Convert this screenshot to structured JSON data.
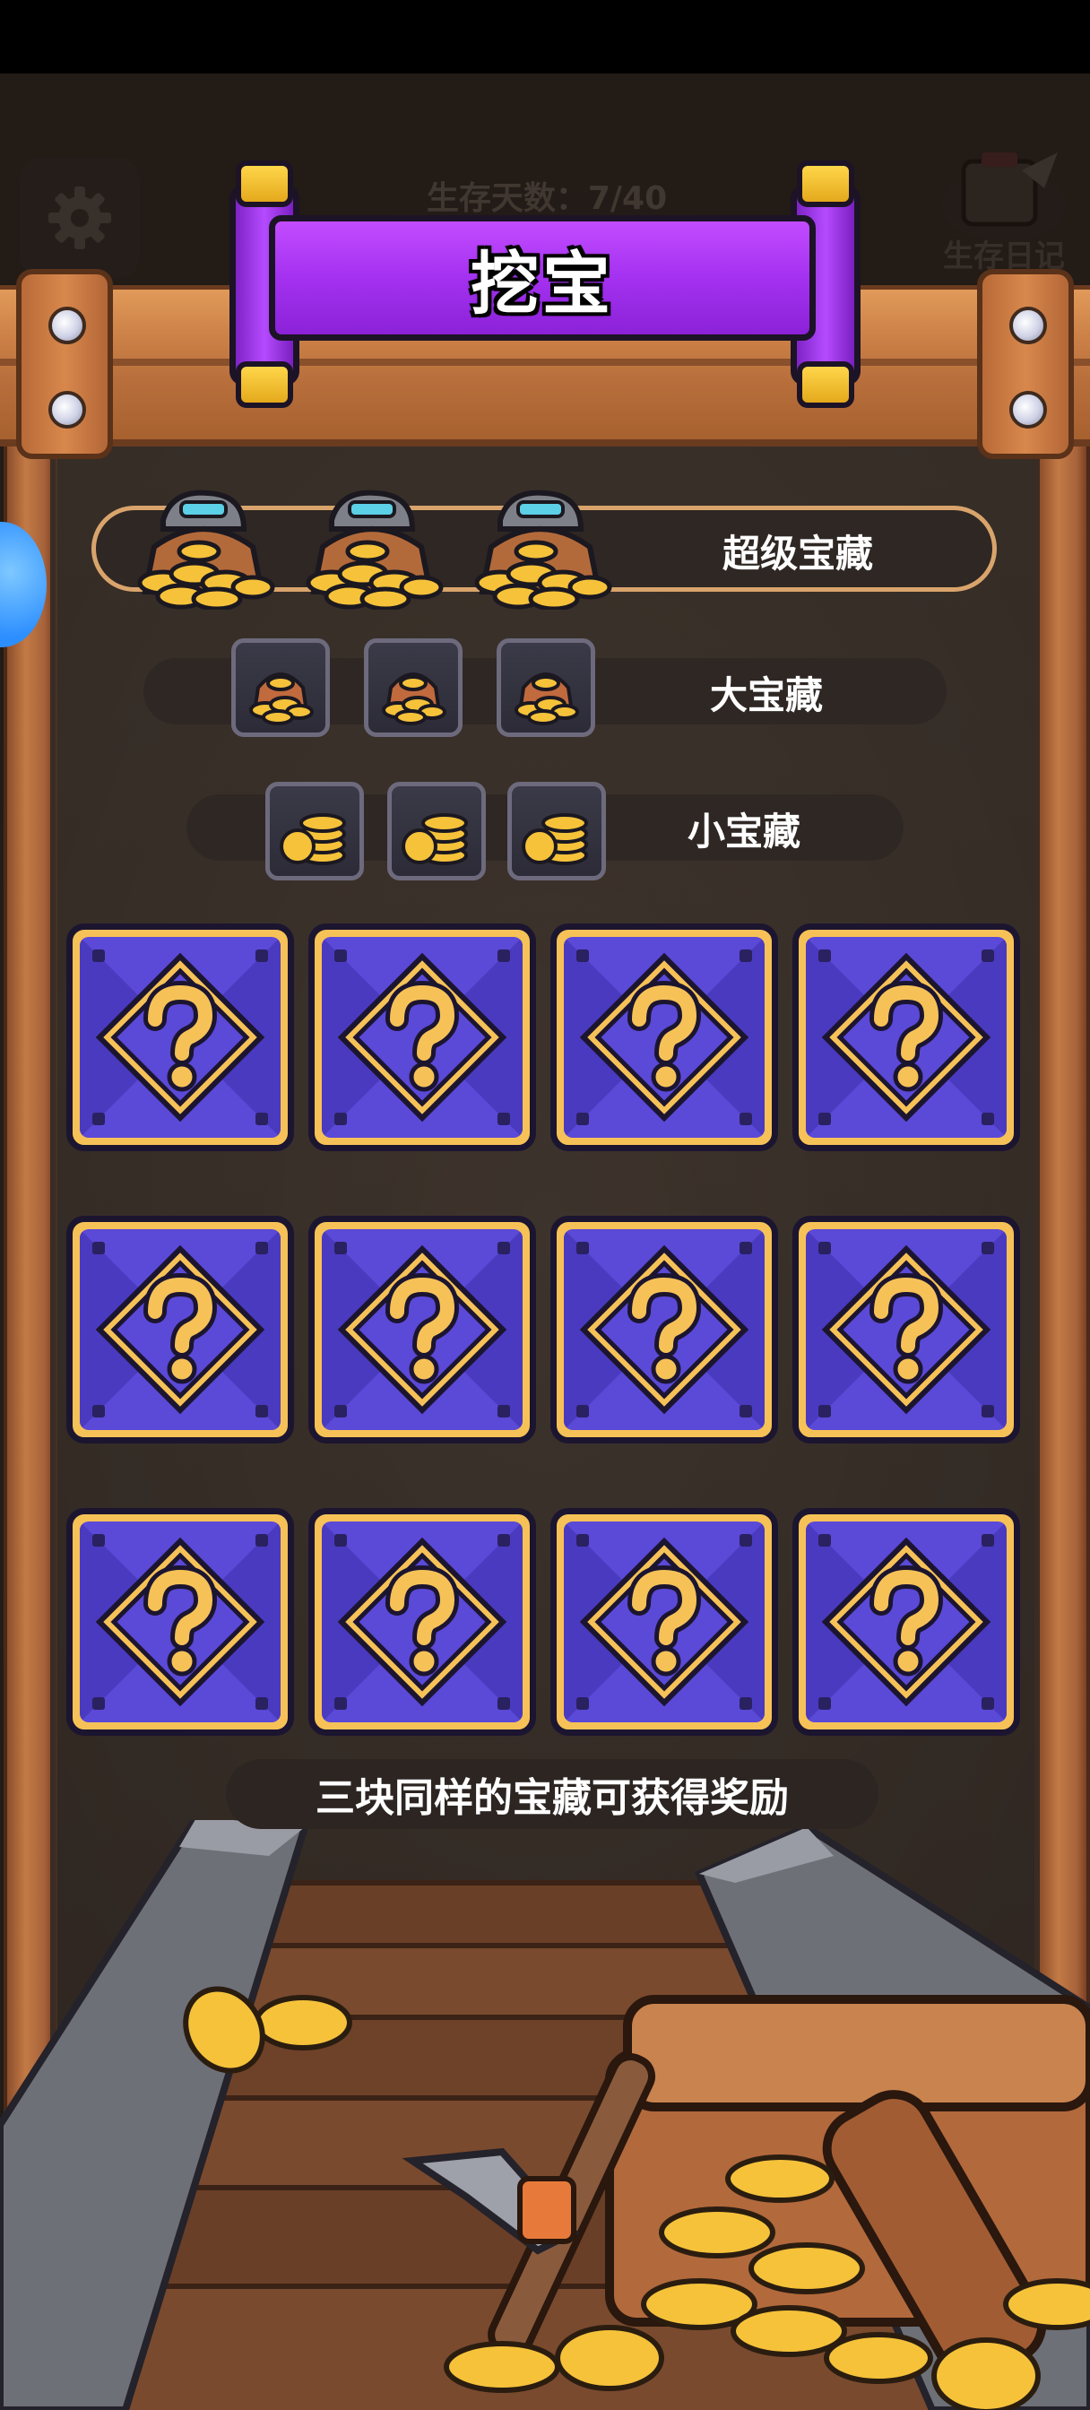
{
  "header": {
    "days_text": "生存天数：7/40",
    "diary_label": "生存日记",
    "settings_icon": "gear-icon"
  },
  "banner": {
    "title": "挖宝"
  },
  "rewards": [
    {
      "label": "超级宝藏",
      "icon": "treasure-pile-super-icon",
      "count": 3
    },
    {
      "label": "大宝藏",
      "icon": "treasure-sack-icon",
      "count": 3
    },
    {
      "label": "小宝藏",
      "icon": "coin-stack-icon",
      "count": 3
    }
  ],
  "grid": {
    "rows": 3,
    "cols": 4,
    "tile_icon": "question-mark-icon",
    "tile_state": "hidden"
  },
  "hint": "三块同样的宝藏可获得奖励",
  "colors": {
    "tile_gold": "#f6c257",
    "tile_purple": "#5b49d7",
    "banner_purple": "#a431f0",
    "frame_wood": "#c37a45"
  }
}
